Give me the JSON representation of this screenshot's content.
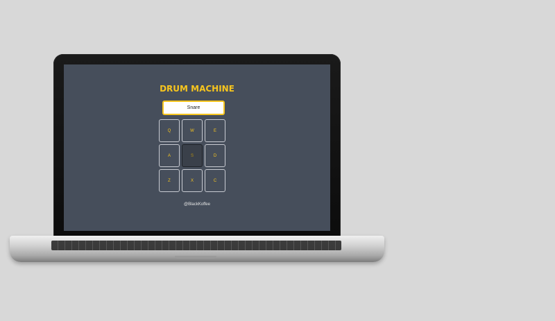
{
  "app": {
    "title": "DRUM MACHINE",
    "display": "Snare",
    "credit": "@BlackKoffee"
  },
  "pads": [
    {
      "key": "Q"
    },
    {
      "key": "W"
    },
    {
      "key": "E"
    },
    {
      "key": "A"
    },
    {
      "key": "S"
    },
    {
      "key": "D"
    },
    {
      "key": "Z"
    },
    {
      "key": "X"
    },
    {
      "key": "C"
    }
  ],
  "colors": {
    "accent": "#f7c51e",
    "screen_bg": "#464e5b",
    "pad_border": "#c9ccd3"
  }
}
